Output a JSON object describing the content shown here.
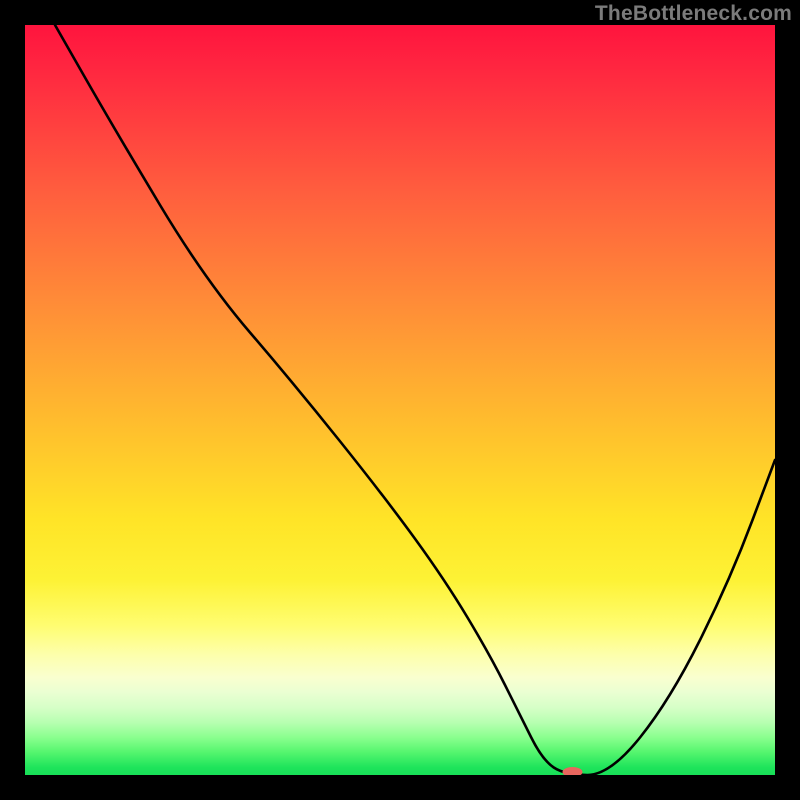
{
  "watermark": "TheBottleneck.com",
  "chart_data": {
    "type": "line",
    "title": "",
    "xlabel": "",
    "ylabel": "",
    "xlim": [
      0,
      100
    ],
    "ylim": [
      0,
      100
    ],
    "series": [
      {
        "name": "curve",
        "x": [
          4,
          12,
          24,
          36,
          48,
          56,
          62,
          66,
          69,
          72,
          78,
          86,
          94,
          100
        ],
        "y": [
          100,
          86,
          66,
          52,
          37,
          26,
          16,
          8,
          2,
          0,
          0,
          10,
          26,
          42
        ]
      }
    ],
    "marker": {
      "x": 73,
      "y": 0,
      "color": "#e8665e",
      "rx": 10,
      "ry": 5
    },
    "background": {
      "type": "vertical-gradient",
      "stops": [
        {
          "pos": 0,
          "color": "#ff143e"
        },
        {
          "pos": 50,
          "color": "#ffb030"
        },
        {
          "pos": 80,
          "color": "#feff80"
        },
        {
          "pos": 100,
          "color": "#18df58"
        }
      ]
    }
  }
}
